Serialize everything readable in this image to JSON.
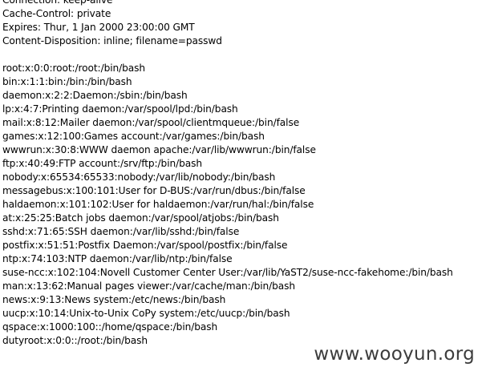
{
  "headers": [
    "Connection: keep-alive",
    "Cache-Control: private",
    "Expires: Thur, 1 Jan 2000 23:00:00 GMT",
    "Content-Disposition: inline; filename=passwd"
  ],
  "body_lines": [
    "root:x:0:0:root:/root:/bin/bash",
    "bin:x:1:1:bin:/bin:/bin/bash",
    "daemon:x:2:2:Daemon:/sbin:/bin/bash",
    "lp:x:4:7:Printing daemon:/var/spool/lpd:/bin/bash",
    "mail:x:8:12:Mailer daemon:/var/spool/clientmqueue:/bin/false",
    "games:x:12:100:Games account:/var/games:/bin/bash",
    "wwwrun:x:30:8:WWW daemon apache:/var/lib/wwwrun:/bin/false",
    "ftp:x:40:49:FTP account:/srv/ftp:/bin/bash",
    "nobody:x:65534:65533:nobody:/var/lib/nobody:/bin/bash",
    "messagebus:x:100:101:User for D-BUS:/var/run/dbus:/bin/false",
    "haldaemon:x:101:102:User for haldaemon:/var/run/hal:/bin/false",
    "at:x:25:25:Batch jobs daemon:/var/spool/atjobs:/bin/bash",
    "sshd:x:71:65:SSH daemon:/var/lib/sshd:/bin/false",
    "postfix:x:51:51:Postfix Daemon:/var/spool/postfix:/bin/false",
    "ntp:x:74:103:NTP daemon:/var/lib/ntp:/bin/false",
    "suse-ncc:x:102:104:Novell Customer Center User:/var/lib/YaST2/suse-ncc-fakehome:/bin/bash",
    "man:x:13:62:Manual pages viewer:/var/cache/man:/bin/bash",
    "news:x:9:13:News system:/etc/news:/bin/bash",
    "uucp:x:10:14:Unix-to-Unix CoPy system:/etc/uucp:/bin/bash",
    "qspace:x:1000:100::/home/qspace:/bin/bash",
    "dutyroot:x:0:0::/root:/bin/bash"
  ],
  "watermark": "www.wooyun.org"
}
